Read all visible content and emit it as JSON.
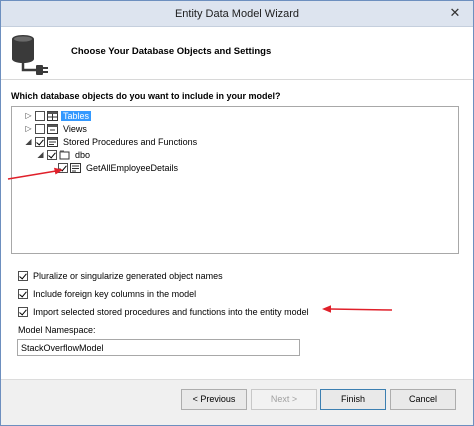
{
  "window": {
    "title": "Entity Data Model Wizard",
    "close_glyph": "✕"
  },
  "header": {
    "icon": "database-plug-icon",
    "text": "Choose Your Database Objects and Settings"
  },
  "question": "Which database objects do you want to include in your model?",
  "tree": {
    "items": [
      {
        "label": "Tables",
        "checked": false,
        "expanded": false,
        "icon": "table-icon",
        "selected": true
      },
      {
        "label": "Views",
        "checked": false,
        "expanded": false,
        "icon": "view-icon",
        "selected": false
      },
      {
        "label": "Stored Procedures and Functions",
        "checked": true,
        "expanded": true,
        "icon": "stored-procedure-icon",
        "selected": false
      },
      {
        "label": "dbo",
        "checked": true,
        "expanded": true,
        "icon": "schema-icon",
        "selected": false
      },
      {
        "label": "GetAllEmployeeDetails",
        "checked": true,
        "expanded": false,
        "icon": "function-icon",
        "selected": false
      }
    ]
  },
  "options": [
    {
      "label": "Pluralize or singularize generated object names",
      "checked": true
    },
    {
      "label": "Include foreign key columns in the model",
      "checked": true
    },
    {
      "label": "Import selected stored procedures and functions into the entity model",
      "checked": true
    }
  ],
  "namespace": {
    "label": "Model Namespace:",
    "value": "StackOverflowModel"
  },
  "buttons": {
    "previous": "< Previous",
    "next": "Next >",
    "finish": "Finish",
    "cancel": "Cancel"
  },
  "colors": {
    "annotation_arrow": "#e0202a",
    "selection": "#3399ff"
  }
}
